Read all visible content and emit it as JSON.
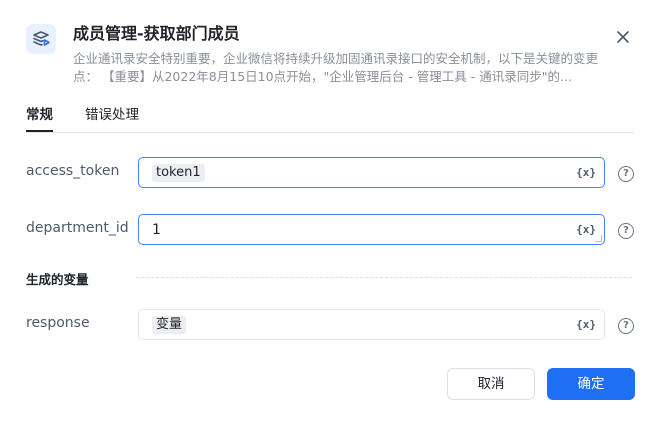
{
  "dialog": {
    "title": "成员管理-获取部门成员",
    "description": "企业通讯录安全特别重要，企业微信将持续升级加固通讯录接口的安全机制，以下是关键的变更点： 【重要】从2022年8月15日10点开始，\"企业管理后台 - 管理工具 - 通讯录同步\"的...",
    "app_icon": "layers-icon",
    "close_icon": "close-icon"
  },
  "tabs": [
    {
      "label": "常规",
      "active": true
    },
    {
      "label": "错误处理",
      "active": false
    }
  ],
  "fields": {
    "access_token": {
      "label": "access_token",
      "value": "token1",
      "var_marker": "{x}",
      "help": "?"
    },
    "department_id": {
      "label": "department_id",
      "value": "1",
      "var_marker": "{x}",
      "help": "?"
    }
  },
  "output": {
    "section_title": "生成的变量",
    "response": {
      "label": "response",
      "value": "变量",
      "var_marker": "{x}",
      "help": "?"
    }
  },
  "buttons": {
    "cancel": "取消",
    "ok": "确定"
  },
  "colors": {
    "primary": "#1f6ff5",
    "focus_border": "#3d82f6"
  }
}
